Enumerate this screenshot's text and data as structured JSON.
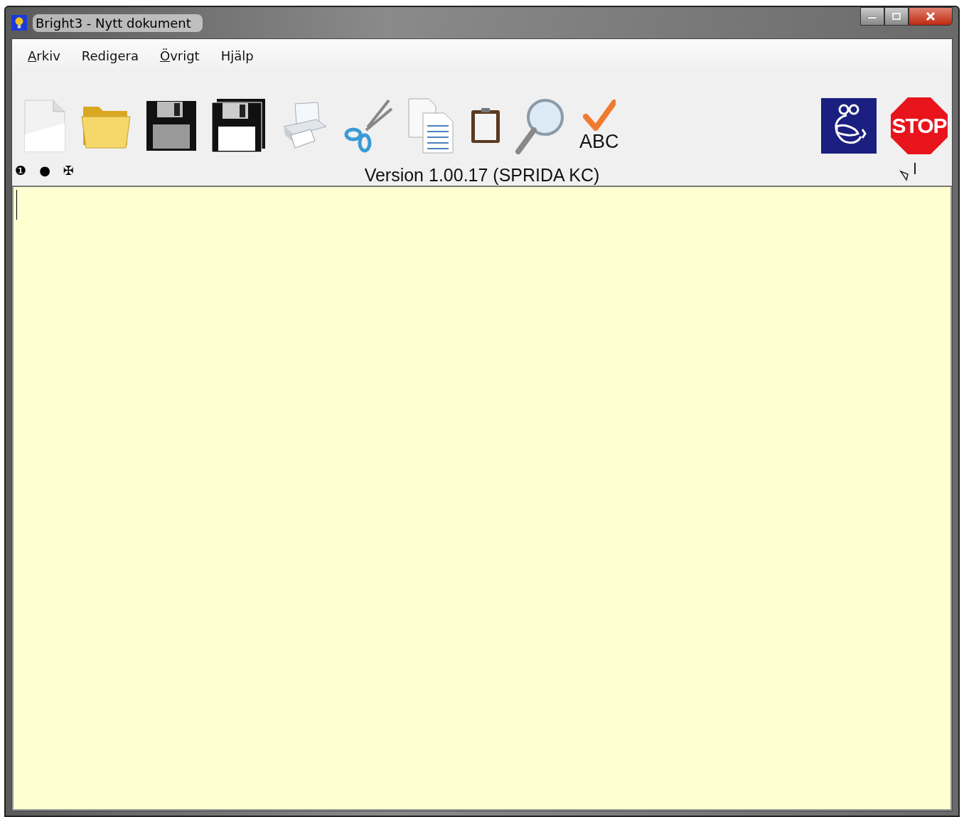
{
  "window": {
    "title": "Bright3 - Nytt dokument"
  },
  "menu": [
    {
      "label": "Arkiv",
      "underlined": true
    },
    {
      "label": "Redigera",
      "underlined": false
    },
    {
      "label": "Övrigt",
      "underlined": true
    },
    {
      "label": "Hjälp",
      "underlined": false
    }
  ],
  "toolbar": [
    {
      "kind": "new"
    },
    {
      "kind": "open"
    },
    {
      "kind": "save"
    },
    {
      "kind": "save_all"
    },
    {
      "kind": "print"
    },
    {
      "kind": "cut"
    },
    {
      "kind": "copy"
    },
    {
      "kind": "paste"
    },
    {
      "kind": "search"
    },
    {
      "kind": "spellcheck",
      "label": "ABC"
    }
  ],
  "toolbar_right": [
    {
      "kind": "help"
    },
    {
      "kind": "stop",
      "label": "STOP"
    }
  ],
  "indicators": [
    "❶",
    "●",
    "✠"
  ],
  "version": "Version 1.00.17 (SPRIDA KC)"
}
